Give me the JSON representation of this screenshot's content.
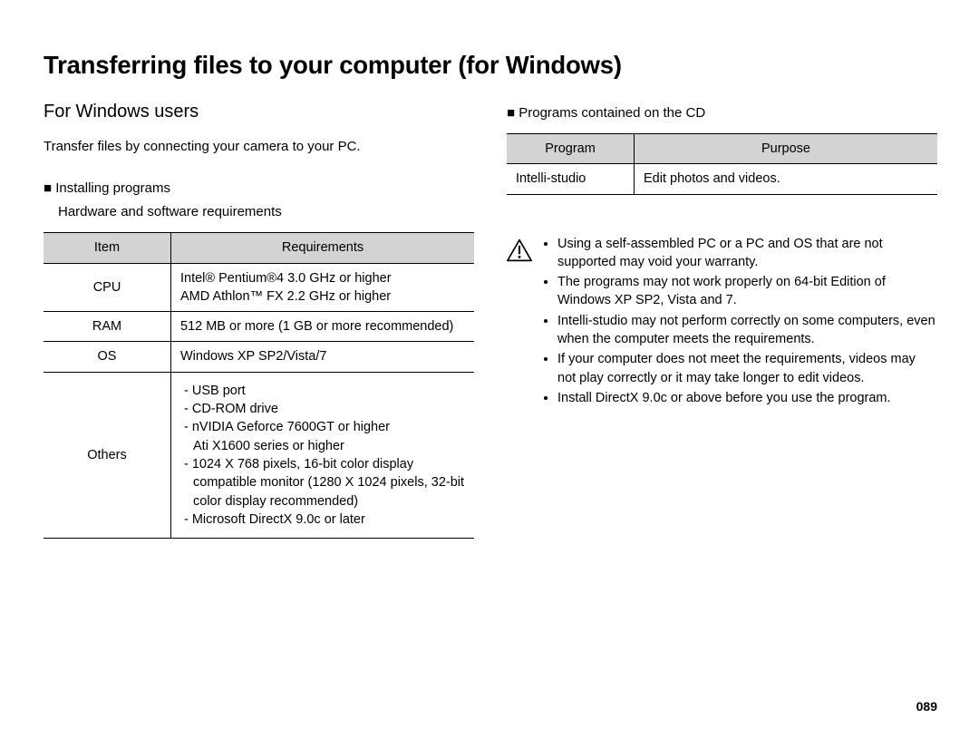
{
  "title": "Transferring files to your computer (for Windows)",
  "left": {
    "section_title": "For Windows users",
    "intro": "Transfer files by connecting your camera to your PC.",
    "installing_heading": "Installing programs",
    "hw_sw_req": "Hardware and software requirements",
    "table": {
      "head_item": "Item",
      "head_req": "Requirements",
      "rows": {
        "cpu_label": "CPU",
        "cpu_req_l1": "Intel® Pentium®4 3.0 GHz or higher",
        "cpu_req_l2": "AMD Athlon™ FX 2.2 GHz or higher",
        "ram_label": "RAM",
        "ram_req": "512 MB or more (1 GB or more recommended)",
        "os_label": "OS",
        "os_req": "Windows XP SP2/Vista/7",
        "others_label": "Others",
        "others_items": {
          "a": "- USB port",
          "b": "- CD-ROM drive",
          "c": "- nVIDIA Geforce 7600GT or higher",
          "c2": "Ati X1600 series or higher",
          "d": "- 1024 X 768 pixels, 16-bit color display compatible monitor (1280 X 1024 pixels, 32-bit color display recommended)",
          "e": "- Microsoft DirectX 9.0c or later"
        }
      }
    }
  },
  "right": {
    "programs_heading": "Programs contained on the CD",
    "programs_table": {
      "head_program": "Program",
      "head_purpose": "Purpose",
      "row1_program": "Intelli-studio",
      "row1_purpose": "Edit photos and videos."
    },
    "caution": {
      "items": {
        "a": "Using a self-assembled PC or a PC and OS that are not supported may void your warranty.",
        "b": "The programs may not work properly on 64-bit Edition of Windows XP SP2, Vista and 7.",
        "c": "Intelli-studio may not perform correctly on some computers, even when the computer meets the requirements.",
        "d": "If your computer does not meet the requirements, videos may not play correctly or it may take longer to edit videos.",
        "e": "Install DirectX 9.0c or above before you use the program."
      }
    }
  },
  "page_number": "089"
}
